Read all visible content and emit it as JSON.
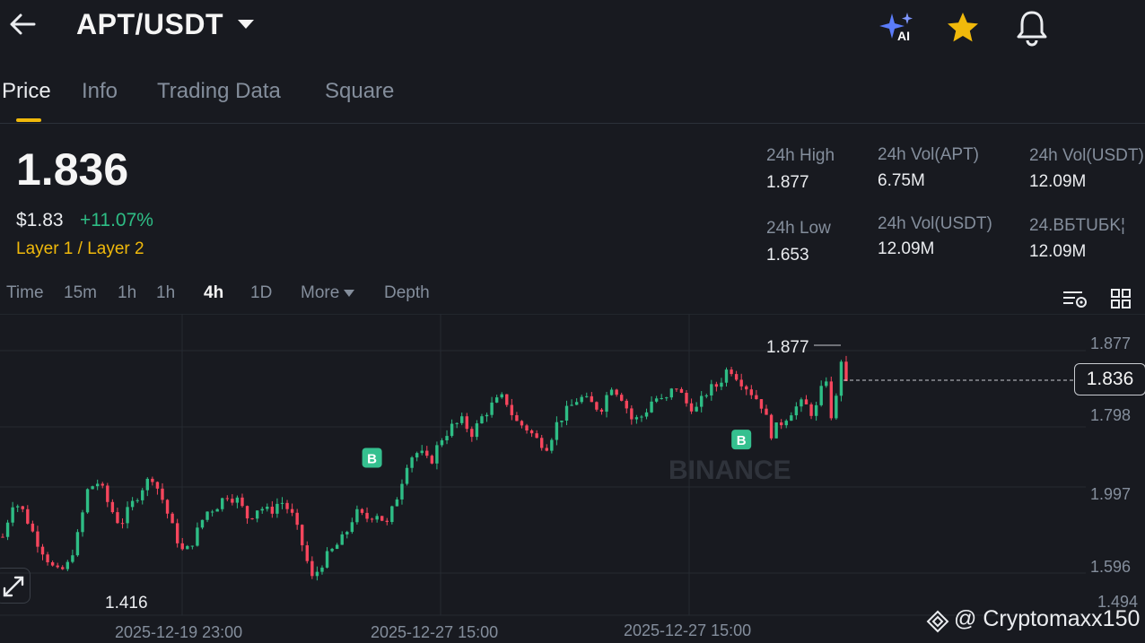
{
  "header": {
    "pair": "APT/USDT"
  },
  "icons": {
    "back": "arrow-left-icon",
    "dropdown": "caret-down-icon",
    "ai": "ai-sparkle-icon",
    "favorite": "star-icon",
    "alerts": "bell-icon"
  },
  "colors": {
    "up": "#2ebd85",
    "down": "#f6465d",
    "accent": "#f0b90b",
    "background": "#181a20",
    "ai": "#5b7cfa"
  },
  "ai_label": "AI",
  "tabs": [
    {
      "label": "Price",
      "active": true
    },
    {
      "label": "Info"
    },
    {
      "label": "Trading Data"
    },
    {
      "label": "Square"
    }
  ],
  "ticker": {
    "last_price": "1.836",
    "usd_price": "$1.83",
    "change_pct": "+11.07%",
    "category": "Layer 1 / Layer 2"
  },
  "stats": [
    {
      "label": "24h High",
      "value": "1.877"
    },
    {
      "label": "24h Vol(APT)",
      "value": "6.75M"
    },
    {
      "label": "24h Vol(USDT)",
      "value": "12.09M"
    },
    {
      "label": "24h Low",
      "value": "1.653"
    },
    {
      "label": "24h Vol(USDT)",
      "value": "12.09M"
    },
    {
      "label": "24.BБTUБK¦",
      "value": "12.09M"
    }
  ],
  "timeframes": [
    {
      "label": "Time"
    },
    {
      "label": "15m"
    },
    {
      "label": "1h"
    },
    {
      "label": "1h"
    },
    {
      "label": "4h",
      "active": true
    },
    {
      "label": "1D"
    },
    {
      "label": "More"
    },
    {
      "label": "Depth"
    }
  ],
  "chart_data": {
    "type": "candlestick",
    "y_axis_labels": [
      "1.877",
      "1.798",
      "1.997",
      "1.596",
      "1.494"
    ],
    "x_axis_labels": [
      "2025-12-19 23:00",
      "2025-12-27 15:00",
      "2025-12-27 15:00"
    ],
    "high_marker": "1.877",
    "low_marker": "1.416",
    "current_price": "1.836",
    "buy_marker_label": "B",
    "buy_markers": [
      {
        "near_index": 74,
        "price": 1.71
      },
      {
        "near_index": 148,
        "price": 1.74
      }
    ],
    "y_range": [
      1.46,
      1.895
    ],
    "candle_count": 170,
    "close_series": [
      1.58,
      1.64,
      1.62,
      1.58,
      1.55,
      1.52,
      1.53,
      1.58,
      1.66,
      1.67,
      1.63,
      1.6,
      1.63,
      1.66,
      1.68,
      1.64,
      1.59,
      1.55,
      1.58,
      1.62,
      1.63,
      1.65,
      1.64,
      1.61,
      1.63,
      1.62,
      1.64,
      1.62,
      1.57,
      1.51,
      1.54,
      1.56,
      1.58,
      1.62,
      1.61,
      1.62,
      1.6,
      1.65,
      1.71,
      1.72,
      1.7,
      1.74,
      1.76,
      1.77,
      1.75,
      1.78,
      1.8,
      1.81,
      1.77,
      1.76,
      1.74,
      1.73,
      1.77,
      1.79,
      1.81,
      1.8,
      1.79,
      1.83,
      1.81,
      1.77,
      1.78,
      1.81,
      1.8,
      1.83,
      1.8,
      1.79,
      1.82,
      1.83,
      1.86,
      1.84,
      1.82,
      1.8,
      1.75,
      1.77,
      1.79,
      1.8,
      1.78,
      1.84,
      1.85,
      1.84
    ],
    "last_close": 1.836
  },
  "watermark": "@ Cryptomaxx150",
  "watermark_bg": "BINANCE"
}
